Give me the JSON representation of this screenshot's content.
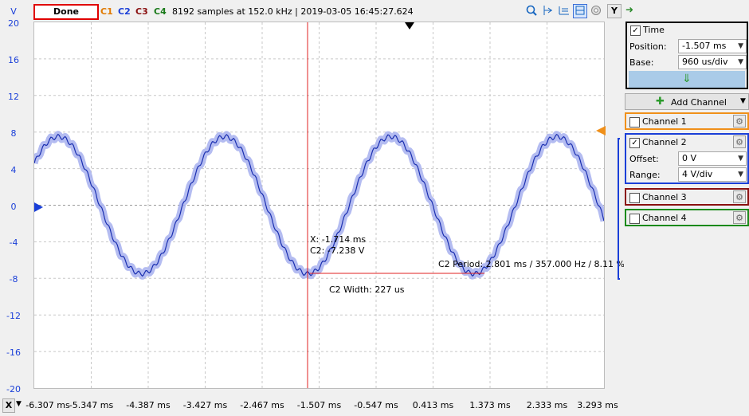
{
  "toolbar": {
    "status": "Done",
    "channels": [
      {
        "label": "C1",
        "color": "#e07a00"
      },
      {
        "label": "C2",
        "color": "#1a3fd8"
      },
      {
        "label": "C3",
        "color": "#8a1010"
      },
      {
        "label": "C4",
        "color": "#1a7a1a"
      }
    ],
    "info": "8192 samples at 152.0 kHz | 2019-03-05 16:45:27.624",
    "tools": [
      "zoom-icon",
      "cursor-x-icon",
      "cursor-y-icon",
      "measure-icon",
      "settings-icon"
    ],
    "y_button": "Y",
    "next_arrow": "➜"
  },
  "y_axis": {
    "unit": "V",
    "labels": [
      "20",
      "16",
      "12",
      "8",
      "4",
      "0",
      "-4",
      "-8",
      "-12",
      "-16",
      "-20"
    ]
  },
  "x_axis": {
    "button": "X",
    "labels": [
      "-6.307 ms",
      "-5.347 ms",
      "-4.387 ms",
      "-3.427 ms",
      "-2.467 ms",
      "-1.507 ms",
      "-0.547 ms",
      "0.413 ms",
      "1.373 ms",
      "2.333 ms",
      "3.293 ms"
    ]
  },
  "cursor": {
    "x_readout": "X: -1.714 ms",
    "c2_readout": "C2: -7.238 V",
    "period_readout": "C2 Period: 2.801 ms / 357.000 Hz / 8.11 %",
    "width_readout": "C2 Width: 227 us"
  },
  "chart_data": {
    "type": "line",
    "series": [
      {
        "name": "C2",
        "amplitude": 7.5,
        "period_ms": 2.801,
        "color": "#1a3fd8"
      }
    ],
    "xlim": [
      -6.307,
      3.293
    ],
    "ylim": [
      -20,
      20
    ],
    "grid": true
  },
  "panel": {
    "time": {
      "label": "Time",
      "checked": "✓",
      "position_label": "Position:",
      "position_value": "-1.507 ms",
      "base_label": "Base:",
      "base_value": "960 us/div",
      "apply_arrow": "⇓"
    },
    "add_channel": "Add Channel",
    "channels": [
      {
        "label": "Channel 1",
        "color": "#f0901a"
      },
      {
        "label": "Channel 2",
        "color": "#1a3fd8",
        "checked": "✓",
        "offset_label": "Offset:",
        "offset_value": "0 V",
        "range_label": "Range:",
        "range_value": "4 V/div"
      },
      {
        "label": "Channel 3",
        "color": "#8a1010"
      },
      {
        "label": "Channel 4",
        "color": "#1a8a1a"
      }
    ]
  }
}
